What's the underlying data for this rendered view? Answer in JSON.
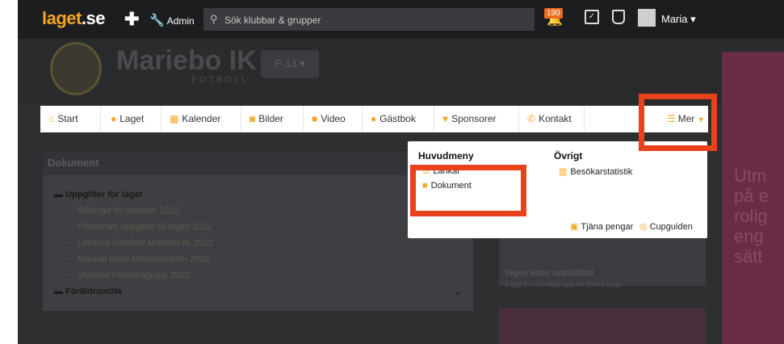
{
  "topbar": {
    "logo_text_a": "laget",
    "logo_text_b": ".se",
    "admin_label": "Admin",
    "search_placeholder": "Sök klubbar & grupper",
    "notification_count": "190",
    "user_name": "Maria"
  },
  "club": {
    "name": "Mariebo IK",
    "sport": "FOTBOLL",
    "team": "P-13"
  },
  "nav": {
    "items": [
      {
        "label": "Start"
      },
      {
        "label": "Laget"
      },
      {
        "label": "Kalender"
      },
      {
        "label": "Bilder"
      },
      {
        "label": "Video"
      },
      {
        "label": "Gästbok"
      },
      {
        "label": "Sponsorer"
      },
      {
        "label": "Kontakt"
      }
    ],
    "more_label": "Mer"
  },
  "documents": {
    "title": "Dokument",
    "folder1": "Uppgifter för laget",
    "files": [
      "Riktlinjer till matcher 2022",
      "Föräldrars uppgifter till lagen 2022",
      "Lathund Gästbok Mariebo IK 2022",
      "Manual kiosk Mariebovallen 2022",
      "Styrelse Föräldragrupp 2022"
    ],
    "folder2": "Föräldramöte"
  },
  "video": {
    "title": "Ingen video uppladdad",
    "subtitle": "Lägg in och välja upp en första klipp"
  },
  "dropdown": {
    "col1_heading": "Huvudmeny",
    "col1_items": [
      "Länkar",
      "Dokument"
    ],
    "col2_heading": "Övrigt",
    "col2_items": [
      "Besökarstatistik"
    ],
    "footer_links": [
      "Tjäna pengar",
      "Cupguiden"
    ]
  },
  "side_promo": [
    "Utm",
    "på e",
    "rolig",
    "eng",
    "sätt"
  ],
  "colors": {
    "accent": "#f4a522",
    "highlight_box": "#e8421d",
    "topbar": "#1c1d1f"
  }
}
